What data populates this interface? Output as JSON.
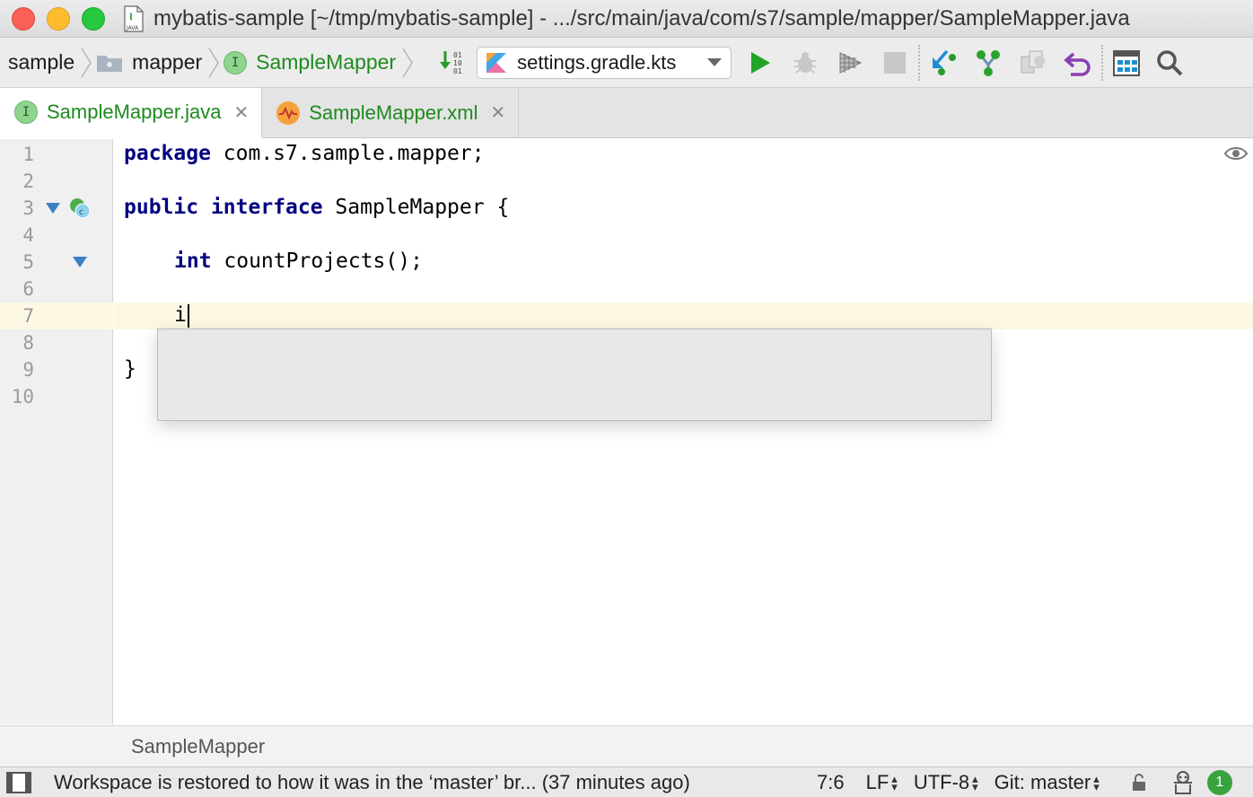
{
  "window": {
    "title": "mybatis-sample [~/tmp/mybatis-sample] - .../src/main/java/com/s7/sample/mapper/SampleMapper.java"
  },
  "navbar": {
    "breadcrumbs": [
      "sample",
      "mapper",
      "SampleMapper"
    ],
    "run_config": "settings.gradle.kts"
  },
  "tabs": [
    {
      "label": "SampleMapper.java",
      "active": true,
      "icon": "interface-icon"
    },
    {
      "label": "SampleMapper.xml",
      "active": false,
      "icon": "mybatis-xml-icon"
    }
  ],
  "editor": {
    "line_numbers": [
      "1",
      "2",
      "3",
      "4",
      "5",
      "6",
      "7",
      "8",
      "9",
      "10"
    ],
    "lines": {
      "l1_kw": "package",
      "l1_rest": " com.s7.sample.mapper;",
      "l3_kw1": "public",
      "l3_kw2": "interface",
      "l3_rest": " SampleMapper {",
      "l5_kw": "int",
      "l5_rest": " countProjects();",
      "l7_text": "i",
      "l9_text": "}"
    },
    "caret_line": 7
  },
  "footer_breadcrumb": "SampleMapper",
  "status": {
    "message": "Workspace is restored to how it was in the ‘master’ br... (37 minutes ago)",
    "position": "7:6",
    "line_separator": "LF",
    "encoding": "UTF-8",
    "vcs": "Git: master",
    "notifications": "1"
  },
  "colors": {
    "keyword": "#000080",
    "accent_green": "#1e8a1e",
    "current_line": "#fdf8e3"
  }
}
